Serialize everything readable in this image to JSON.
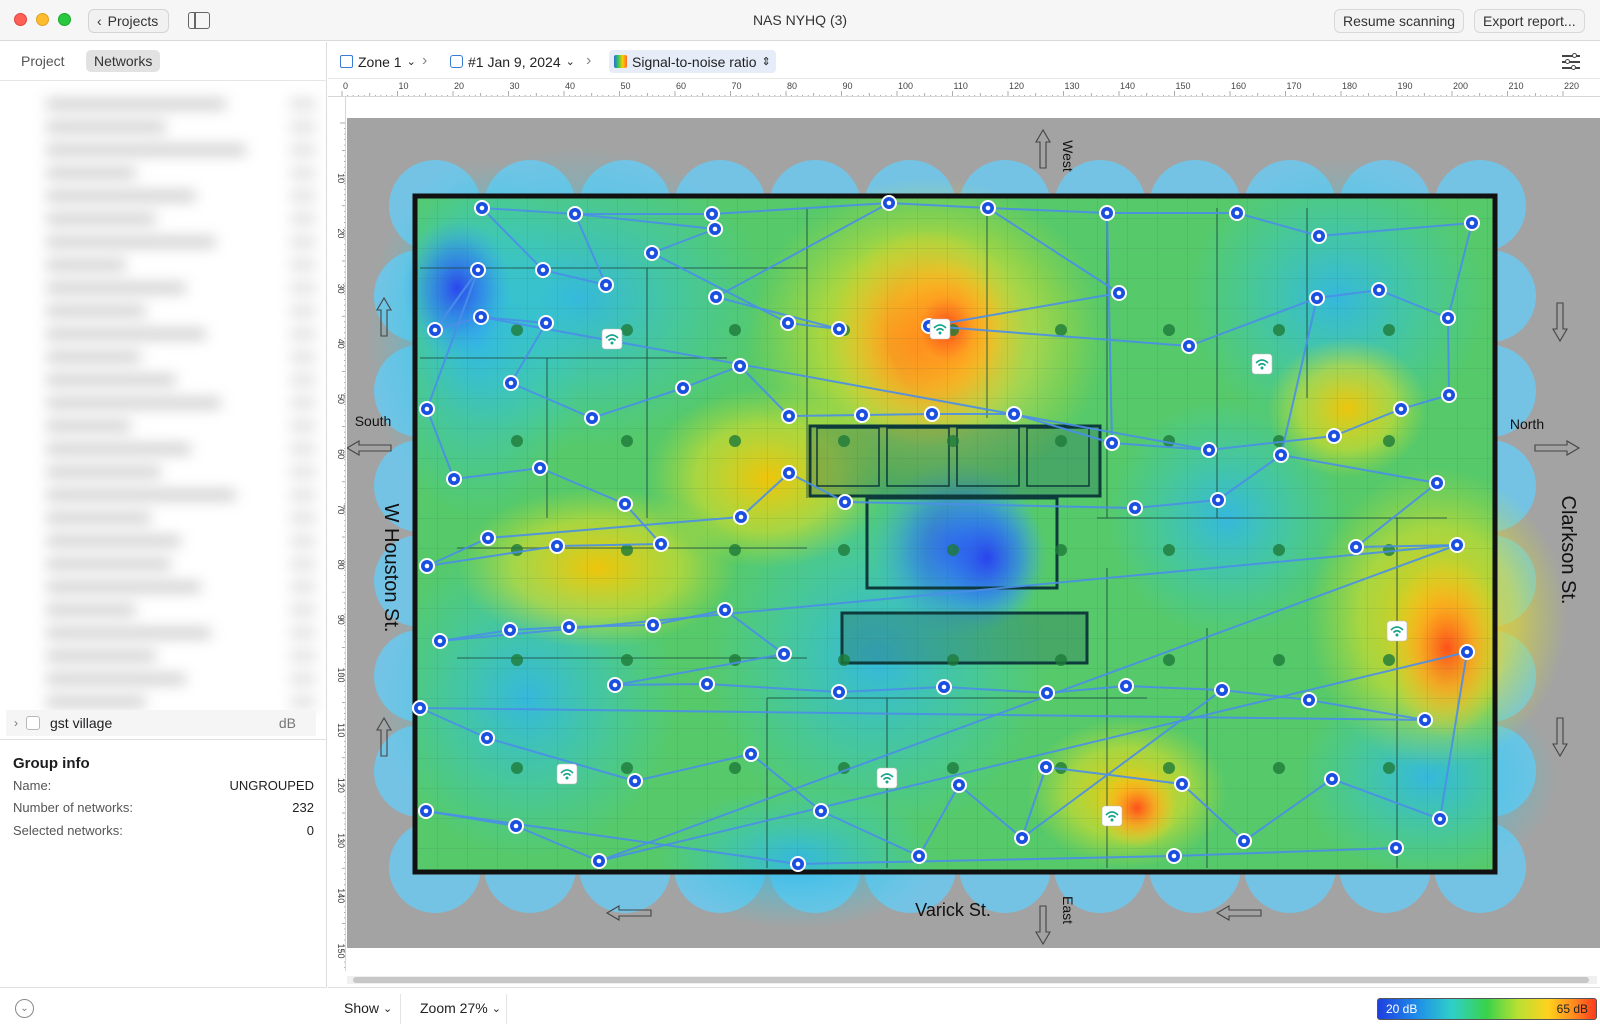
{
  "window": {
    "title": "NAS NYHQ (3)",
    "back_label": "Projects",
    "resume_label": "Resume scanning",
    "export_label": "Export report..."
  },
  "sidebar": {
    "tabs": [
      "Project",
      "Networks"
    ],
    "active_tab": "Networks",
    "group_row": {
      "label": "gst village",
      "unit": "dB"
    },
    "group_info": {
      "title": "Group info",
      "rows": [
        {
          "label": "Name:",
          "value": "UNGROUPED"
        },
        {
          "label": "Number of networks:",
          "value": "232"
        },
        {
          "label": "Selected networks:",
          "value": "0"
        }
      ]
    }
  },
  "toolbar": {
    "zone": "Zone 1",
    "scan": "#1 Jan 9, 2024",
    "visualization": "Signal-to-noise ratio"
  },
  "rulers": {
    "horizontal": [
      "0",
      "10",
      "20",
      "30",
      "40",
      "50",
      "60",
      "70",
      "80",
      "90",
      "100",
      "110",
      "120",
      "130",
      "140",
      "150",
      "160",
      "170",
      "180",
      "190",
      "200",
      "210",
      "220"
    ],
    "vertical": [
      "10",
      "20",
      "30",
      "40",
      "50",
      "60",
      "70",
      "80",
      "90",
      "100",
      "110",
      "120",
      "130",
      "140",
      "150"
    ]
  },
  "map": {
    "streets": {
      "west_street": "W Houston St.",
      "east_street": "Clarkson St.",
      "south_street": "Varick St."
    },
    "compass": {
      "top": "West",
      "bottom": "East",
      "left": "South",
      "right": "North"
    }
  },
  "bottom": {
    "show_label": "Show",
    "zoom_label": "Zoom 27%",
    "legend_min": "20 dB",
    "legend_max": "65 dB"
  },
  "colors": {
    "accent": "#2d6bd8",
    "point": "#1a4fe0",
    "path": "#4a8ee8"
  }
}
